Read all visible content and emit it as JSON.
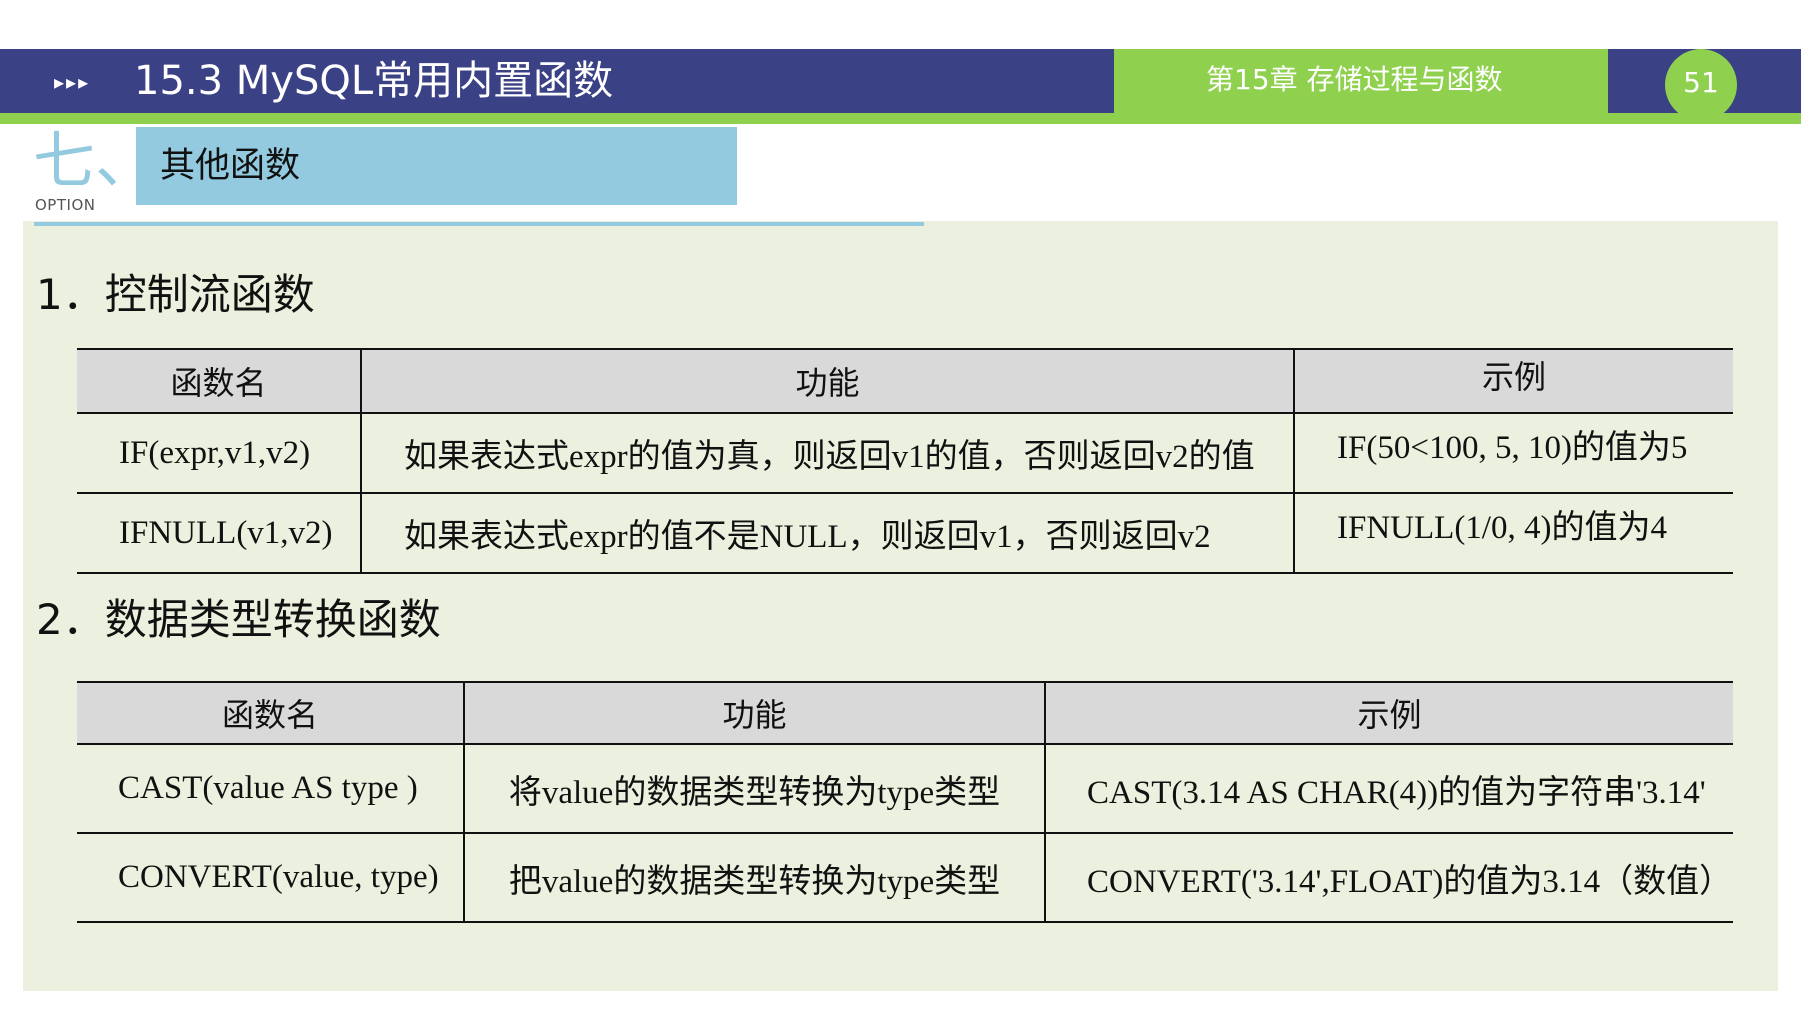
{
  "header": {
    "arrows": "▸▸▸",
    "title": "15.3 MySQL常用内置函数",
    "chapter": "第15章 存储过程与函数",
    "page_number": "51"
  },
  "section": {
    "number": "七、",
    "option_label": "OPTION",
    "title": "其他函数"
  },
  "part1": {
    "heading": "1．控制流函数",
    "columns": [
      "函数名",
      "功能",
      "示例"
    ],
    "rows": [
      {
        "name": "IF(expr,v1,v2)",
        "function": "如果表达式expr的值为真，则返回v1的值，否则返回v2的值",
        "example": "IF(50<100, 5, 10)的值为5"
      },
      {
        "name": "IFNULL(v1,v2)",
        "function": "如果表达式expr的值不是NULL，则返回v1，否则返回v2",
        "example": "IFNULL(1/0, 4)的值为4"
      }
    ]
  },
  "part2": {
    "heading": "2．数据类型转换函数",
    "columns": [
      "函数名",
      "功能",
      "示例"
    ],
    "rows": [
      {
        "name": "CAST(value AS type )",
        "function": "将value的数据类型转换为type类型",
        "example": "CAST(3.14 AS CHAR(4))的值为字符串'3.14'"
      },
      {
        "name": "CONVERT(value, type)",
        "function": "把value的数据类型转换为type类型",
        "example": "CONVERT('3.14',FLOAT)的值为3.14（数值）"
      }
    ]
  },
  "colors": {
    "header_bg": "#3b4185",
    "accent_green": "#8fd14f",
    "section_blue": "#93cadf",
    "content_bg": "#ebf1de",
    "table_header_bg": "#d9d9d9"
  }
}
